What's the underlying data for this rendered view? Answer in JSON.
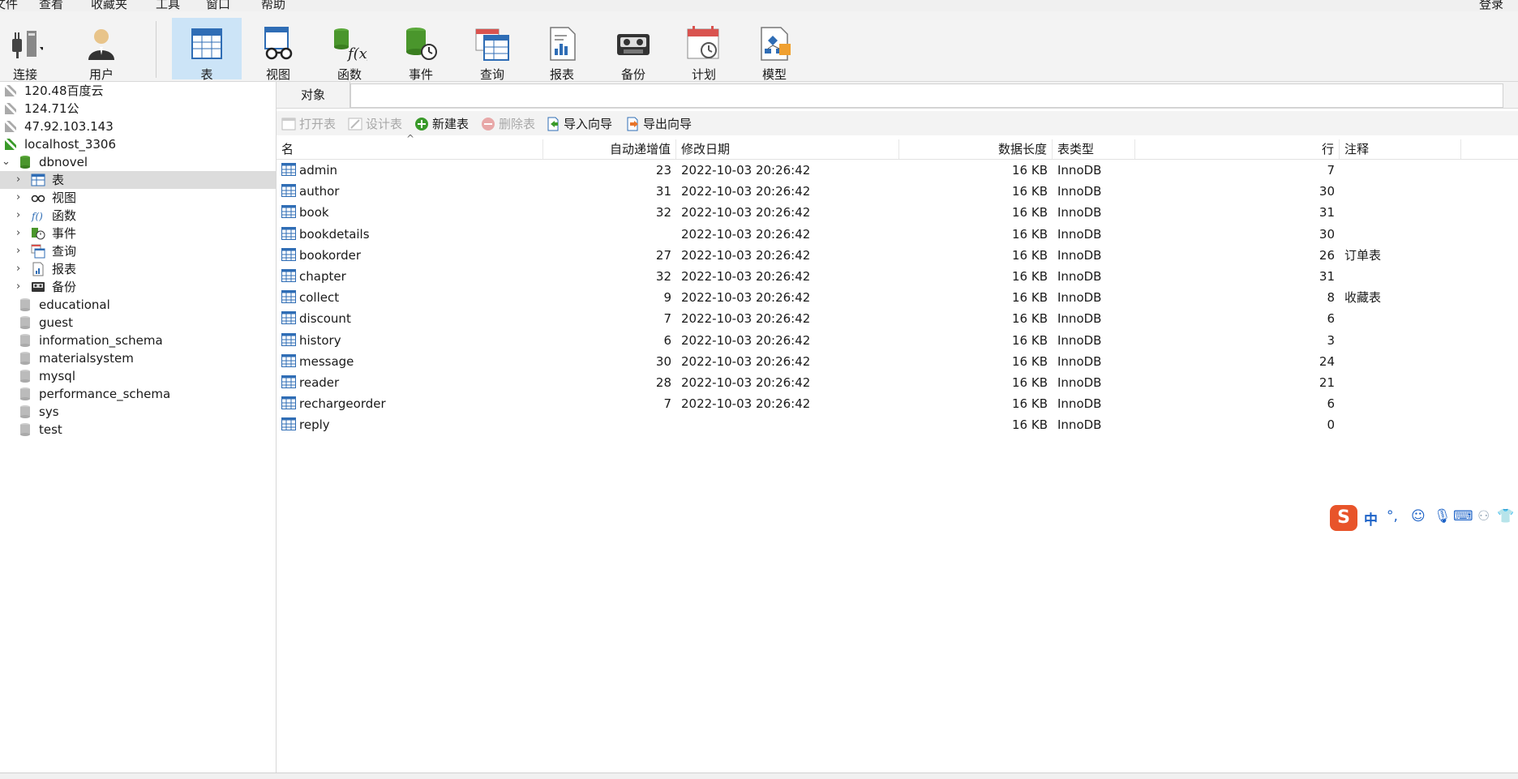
{
  "menu": [
    "文件",
    "查看",
    "收藏夹",
    "工具",
    "窗口",
    "帮助"
  ],
  "login_label": "登录",
  "toolbar": {
    "connect": "连接",
    "user": "用户",
    "table": "表",
    "view": "视图",
    "function": "函数",
    "event": "事件",
    "query": "查询",
    "report": "报表",
    "backup": "备份",
    "schedule": "计划",
    "model": "模型"
  },
  "sidebar": {
    "connections": [
      "120.48百度云",
      "124.71公",
      "47.92.103.143",
      "localhost_3306"
    ],
    "active_db": "dbnovel",
    "db_children": [
      "表",
      "视图",
      "函数",
      "事件",
      "查询",
      "报表",
      "备份"
    ],
    "other_dbs": [
      "educational",
      "guest",
      "information_schema",
      "materialsystem",
      "mysql",
      "performance_schema",
      "sys",
      "test"
    ]
  },
  "main": {
    "tab_label": "对象",
    "actions": {
      "open": "打开表",
      "design": "设计表",
      "new": "新建表",
      "delete": "删除表",
      "import": "导入向导",
      "export": "导出向导"
    },
    "columns": {
      "name": "名",
      "auto_inc": "自动递增值",
      "modified": "修改日期",
      "data_length": "数据长度",
      "engine": "表类型",
      "rows": "行",
      "comment": "注释"
    },
    "rows": [
      {
        "name": "admin",
        "auto_inc": "23",
        "modified": "2022-10-03 20:26:42",
        "data_length": "16 KB",
        "engine": "InnoDB",
        "rows": "7",
        "comment": ""
      },
      {
        "name": "author",
        "auto_inc": "31",
        "modified": "2022-10-03 20:26:42",
        "data_length": "16 KB",
        "engine": "InnoDB",
        "rows": "30",
        "comment": ""
      },
      {
        "name": "book",
        "auto_inc": "32",
        "modified": "2022-10-03 20:26:42",
        "data_length": "16 KB",
        "engine": "InnoDB",
        "rows": "31",
        "comment": ""
      },
      {
        "name": "bookdetails",
        "auto_inc": "",
        "modified": "2022-10-03 20:26:42",
        "data_length": "16 KB",
        "engine": "InnoDB",
        "rows": "30",
        "comment": ""
      },
      {
        "name": "bookorder",
        "auto_inc": "27",
        "modified": "2022-10-03 20:26:42",
        "data_length": "16 KB",
        "engine": "InnoDB",
        "rows": "26",
        "comment": "订单表"
      },
      {
        "name": "chapter",
        "auto_inc": "32",
        "modified": "2022-10-03 20:26:42",
        "data_length": "16 KB",
        "engine": "InnoDB",
        "rows": "31",
        "comment": ""
      },
      {
        "name": "collect",
        "auto_inc": "9",
        "modified": "2022-10-03 20:26:42",
        "data_length": "16 KB",
        "engine": "InnoDB",
        "rows": "8",
        "comment": "收藏表"
      },
      {
        "name": "discount",
        "auto_inc": "7",
        "modified": "2022-10-03 20:26:42",
        "data_length": "16 KB",
        "engine": "InnoDB",
        "rows": "6",
        "comment": ""
      },
      {
        "name": "history",
        "auto_inc": "6",
        "modified": "2022-10-03 20:26:42",
        "data_length": "16 KB",
        "engine": "InnoDB",
        "rows": "3",
        "comment": ""
      },
      {
        "name": "message",
        "auto_inc": "30",
        "modified": "2022-10-03 20:26:42",
        "data_length": "16 KB",
        "engine": "InnoDB",
        "rows": "24",
        "comment": ""
      },
      {
        "name": "reader",
        "auto_inc": "28",
        "modified": "2022-10-03 20:26:42",
        "data_length": "16 KB",
        "engine": "InnoDB",
        "rows": "21",
        "comment": ""
      },
      {
        "name": "rechargeorder",
        "auto_inc": "7",
        "modified": "2022-10-03 20:26:42",
        "data_length": "16 KB",
        "engine": "InnoDB",
        "rows": "6",
        "comment": ""
      },
      {
        "name": "reply",
        "auto_inc": "",
        "modified": "",
        "data_length": "16 KB",
        "engine": "InnoDB",
        "rows": "0",
        "comment": ""
      }
    ]
  },
  "ime": {
    "logo": "S",
    "mode": "中"
  },
  "colors": {
    "accent": "#cce4f7",
    "selection": "#dcdcdc",
    "db_green": "#3a9a2a",
    "table_icon": "#2f6db5"
  }
}
